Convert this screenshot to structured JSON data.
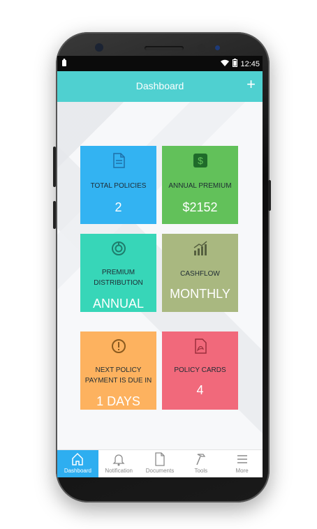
{
  "status": {
    "time": "12:45"
  },
  "appbar": {
    "title": "Dashboard",
    "add_icon": "plus-icon"
  },
  "tiles": [
    {
      "label": "TOTAL POLICIES",
      "value": "2",
      "icon": "document-icon",
      "color": "#33b3f2"
    },
    {
      "label": "ANNUAL PREMIUM",
      "value": "$2152",
      "icon": "dollar-icon",
      "color": "#62c15a"
    },
    {
      "label_line1": "PREMIUM",
      "label_line2": "DISTRIBUTION",
      "value": "ANNUAL",
      "icon": "pie-chart-icon",
      "color": "#37d6b8"
    },
    {
      "label": "CASHFLOW",
      "value": "MONTHLY",
      "icon": "bar-chart-icon",
      "color": "#a9b880"
    },
    {
      "label_line1": "NEXT POLICY",
      "label_line2": "PAYMENT IS DUE IN",
      "value": "1 DAYS",
      "icon": "alert-icon",
      "color": "#fdb25f"
    },
    {
      "label": "POLICY CARDS",
      "value": "4",
      "icon": "pdf-icon",
      "color": "#f1697b"
    }
  ],
  "nav": [
    {
      "label": "Dashboard",
      "icon": "home-icon",
      "active": true
    },
    {
      "label": "Notification",
      "icon": "bell-icon"
    },
    {
      "label": "Documents",
      "icon": "file-icon"
    },
    {
      "label": "Tools",
      "icon": "hammer-icon"
    },
    {
      "label": "More",
      "icon": "menu-icon"
    }
  ],
  "colors": {
    "appbar": "#4fd0d0",
    "nav_active": "#2eaef0"
  }
}
